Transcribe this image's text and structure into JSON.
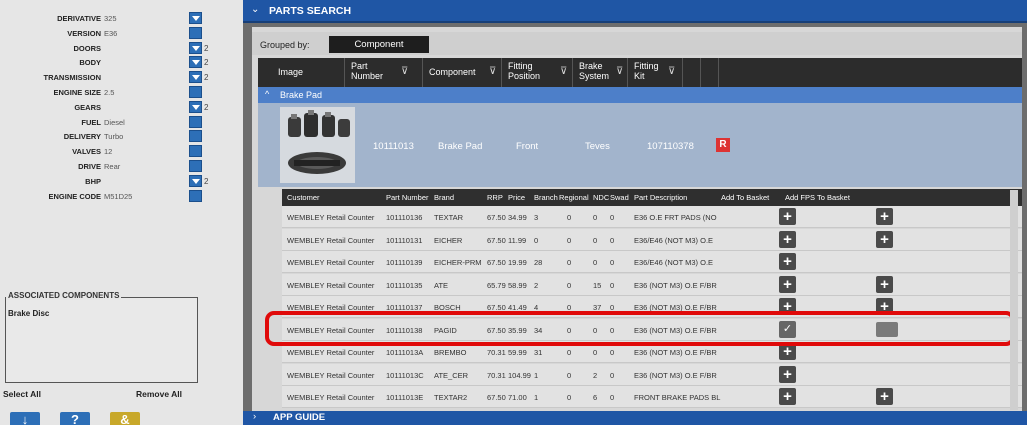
{
  "vehicle": [
    {
      "label": "DERIVATIVE",
      "value": "325",
      "btn": "dd",
      "count": ""
    },
    {
      "label": "VERSION",
      "value": "E36",
      "btn": "bar",
      "count": ""
    },
    {
      "label": "DOORS",
      "value": "",
      "btn": "dd",
      "count": "2"
    },
    {
      "label": "BODY",
      "value": "",
      "btn": "dd",
      "count": "2"
    },
    {
      "label": "TRANSMISSION",
      "value": "",
      "btn": "dd",
      "count": "2"
    },
    {
      "label": "ENGINE SIZE",
      "value": "2.5",
      "btn": "bar",
      "count": ""
    },
    {
      "label": "GEARS",
      "value": "",
      "btn": "dd",
      "count": "2"
    },
    {
      "label": "FUEL",
      "value": "Diesel",
      "btn": "bar",
      "count": ""
    },
    {
      "label": "DELIVERY",
      "value": "Turbo",
      "btn": "bar",
      "count": ""
    },
    {
      "label": "VALVES",
      "value": "12",
      "btn": "bar",
      "count": ""
    },
    {
      "label": "DRIVE",
      "value": "Rear",
      "btn": "bar",
      "count": ""
    },
    {
      "label": "BHP",
      "value": "",
      "btn": "dd",
      "count": "2"
    },
    {
      "label": "ENGINE CODE",
      "value": "M51D25",
      "btn": "bar",
      "count": ""
    }
  ],
  "associated": {
    "title": "ASSOCIATED COMPONENTS",
    "items": [
      "Brake Disc"
    ],
    "select_all": "Select All",
    "remove_all": "Remove All"
  },
  "bottom_icons": [
    {
      "glyph": "↓",
      "color": "#2d6fb7"
    },
    {
      "glyph": "?",
      "color": "#2d6fb7"
    },
    {
      "glyph": "&",
      "color": "#c8a82a"
    }
  ],
  "header": {
    "title": "PARTS SEARCH"
  },
  "grouped": {
    "label": "Grouped by:",
    "value": "Component"
  },
  "columns": [
    "Image",
    "Part Number",
    "Component",
    "Fitting Position",
    "Brake System",
    "Fitting Kit"
  ],
  "group_title": "Brake Pad",
  "product": {
    "part_number": "10111013",
    "component": "Brake Pad",
    "position": "Front",
    "system": "Teves",
    "kit": "107110378",
    "badge": "R"
  },
  "table": {
    "headers": [
      "Customer",
      "Part Number",
      "Brand",
      "RRP",
      "Price",
      "Branch",
      "Regional",
      "NDC",
      "Swad",
      "Part Description",
      "Add To Basket",
      "Add FPS To Basket"
    ],
    "rows": [
      {
        "customer": "WEMBLEY Retail Counter",
        "part": "101110136",
        "brand": "TEXTAR",
        "rrp": "67.50",
        "price": "34.99",
        "branch": "3",
        "regional": "0",
        "ndc": "0",
        "swad": "0",
        "desc": "E36 O.E FRT PADS (NO",
        "basket": "plus",
        "fps": "plus"
      },
      {
        "customer": "WEMBLEY Retail Counter",
        "part": "101110131",
        "brand": "EICHER",
        "rrp": "67.50",
        "price": "11.99",
        "branch": "0",
        "regional": "0",
        "ndc": "0",
        "swad": "0",
        "desc": "E36/E46 (NOT M3) O.E",
        "basket": "plus",
        "fps": "plus"
      },
      {
        "customer": "WEMBLEY Retail Counter",
        "part": "101110139",
        "brand": "EICHER-PRM",
        "rrp": "67.50",
        "price": "19.99",
        "branch": "28",
        "regional": "0",
        "ndc": "0",
        "swad": "0",
        "desc": "E36/E46 (NOT M3) O.E",
        "basket": "plus",
        "fps": ""
      },
      {
        "customer": "WEMBLEY Retail Counter",
        "part": "101110135",
        "brand": "ATE",
        "rrp": "65.79",
        "price": "58.99",
        "branch": "2",
        "regional": "0",
        "ndc": "15",
        "swad": "0",
        "desc": "E36 (NOT M3) O.E F/BR",
        "basket": "plus",
        "fps": "plus"
      },
      {
        "customer": "WEMBLEY Retail Counter",
        "part": "101110137",
        "brand": "BOSCH",
        "rrp": "67.50",
        "price": "41.49",
        "branch": "4",
        "regional": "0",
        "ndc": "37",
        "swad": "0",
        "desc": "E36 (NOT M3) O.E F/BR",
        "basket": "plus",
        "fps": "plus"
      },
      {
        "customer": "WEMBLEY Retail Counter",
        "part": "101110138",
        "brand": "PAGID",
        "rrp": "67.50",
        "price": "35.99",
        "branch": "34",
        "regional": "0",
        "ndc": "0",
        "swad": "0",
        "desc": "E36 (NOT M3) O.E F/BR",
        "basket": "check",
        "fps": "blank"
      },
      {
        "customer": "WEMBLEY Retail Counter",
        "part": "10111013A",
        "brand": "BREMBO",
        "rrp": "70.31",
        "price": "59.99",
        "branch": "31",
        "regional": "0",
        "ndc": "0",
        "swad": "0",
        "desc": "E36 (NOT M3) O.E F/BR",
        "basket": "plus",
        "fps": ""
      },
      {
        "customer": "WEMBLEY Retail Counter",
        "part": "10111013C",
        "brand": "ATE_CER",
        "rrp": "70.31",
        "price": "104.99",
        "branch": "1",
        "regional": "0",
        "ndc": "2",
        "swad": "0",
        "desc": "E36 (NOT M3) O.E F/BR",
        "basket": "plus",
        "fps": ""
      },
      {
        "customer": "WEMBLEY Retail Counter",
        "part": "10111013E",
        "brand": "TEXTAR2",
        "rrp": "67.50",
        "price": "71.00",
        "branch": "1",
        "regional": "0",
        "ndc": "6",
        "swad": "0",
        "desc": "FRONT BRAKE PADS BL",
        "basket": "plus",
        "fps": "plus"
      }
    ]
  },
  "footer": {
    "title": "APP GUIDE"
  }
}
